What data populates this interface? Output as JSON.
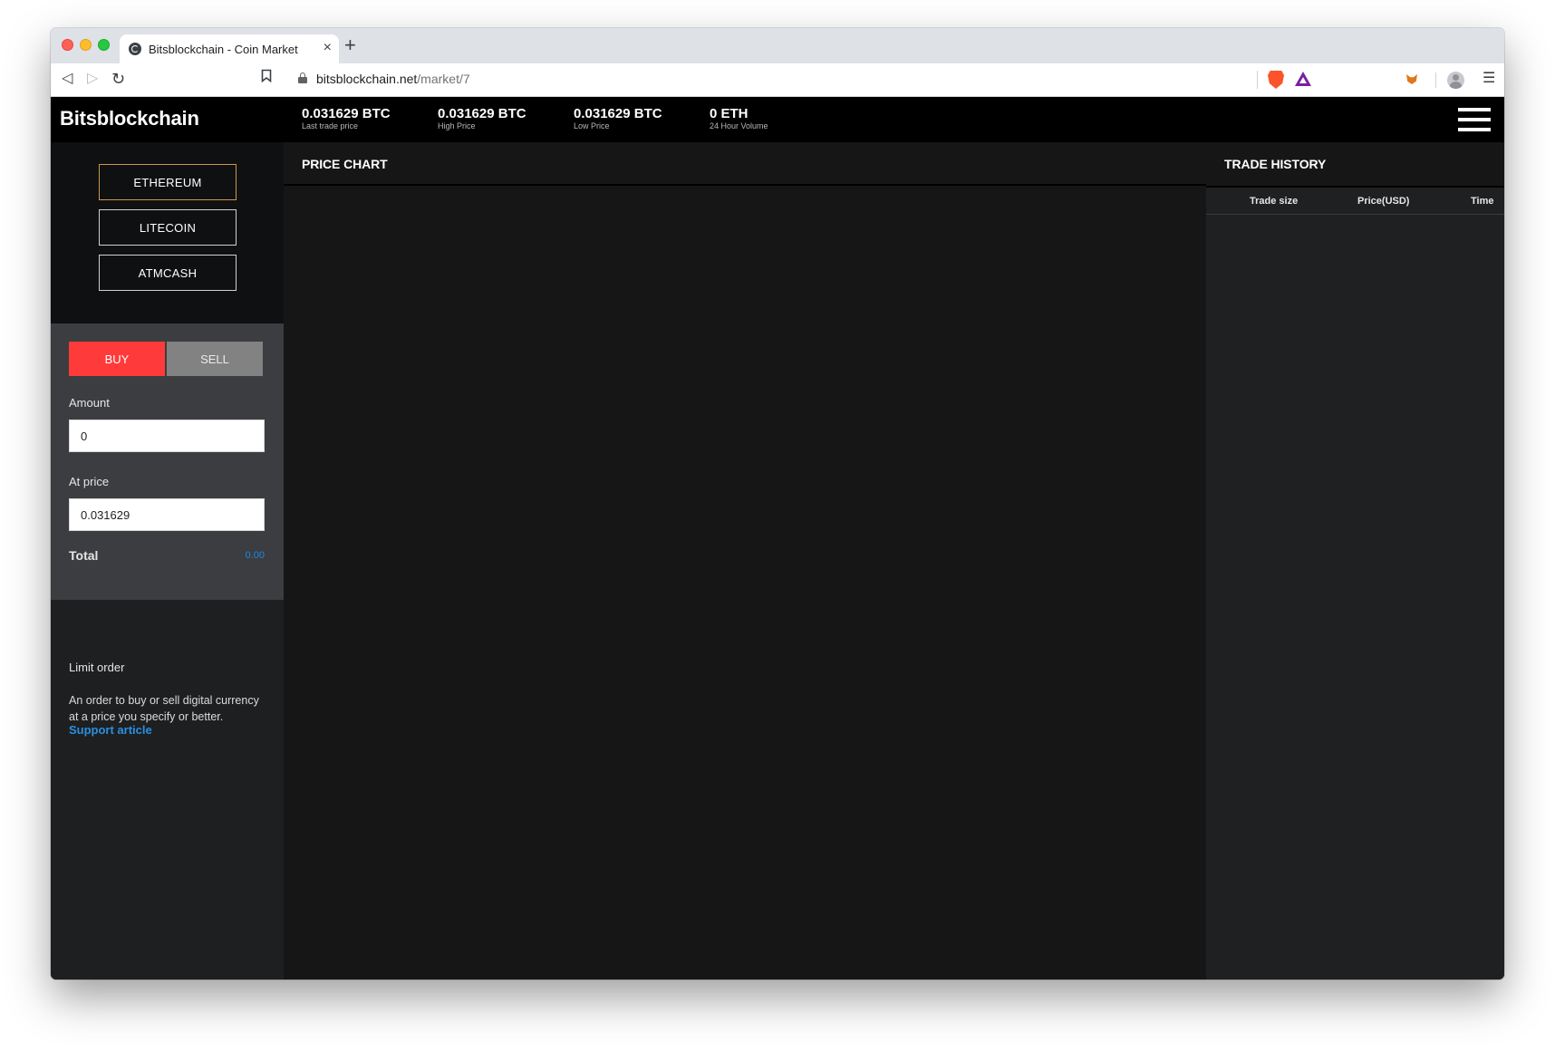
{
  "browser": {
    "tab_title": "Bitsblockchain - Coin Market",
    "url_host": "bitsblockchain.net",
    "url_path": "/market/7"
  },
  "header": {
    "brand": "Bitsblockchain",
    "stats": [
      {
        "value": "0.031629 BTC",
        "label": "Last trade price"
      },
      {
        "value": "0.031629 BTC",
        "label": "High Price"
      },
      {
        "value": "0.031629 BTC",
        "label": "Low Price"
      },
      {
        "value": "0 ETH",
        "label": "24 Hour Volume"
      }
    ]
  },
  "coins": [
    {
      "label": "ETHEREUM",
      "active": true
    },
    {
      "label": "LITECOIN",
      "active": false
    },
    {
      "label": "ATMCASH",
      "active": false
    }
  ],
  "trade_form": {
    "buy_label": "BUY",
    "sell_label": "SELL",
    "amount_label": "Amount",
    "amount_value": "0",
    "price_label": "At price",
    "price_value": "0.031629",
    "total_label": "Total",
    "total_value": "0.00"
  },
  "help": {
    "title": "Limit order",
    "text": "An order to buy or sell digital currency at a price you specify or better.",
    "link": "Support article"
  },
  "chart_panel": {
    "title": "PRICE CHART"
  },
  "trade_history": {
    "title": "TRADE HISTORY",
    "columns": [
      "Trade size",
      "Price(USD)",
      "Time"
    ]
  },
  "colors": {
    "buy": "#ff3a3a",
    "sell": "#828282",
    "link": "#2a8fe0",
    "active_border": "#c9974b"
  }
}
